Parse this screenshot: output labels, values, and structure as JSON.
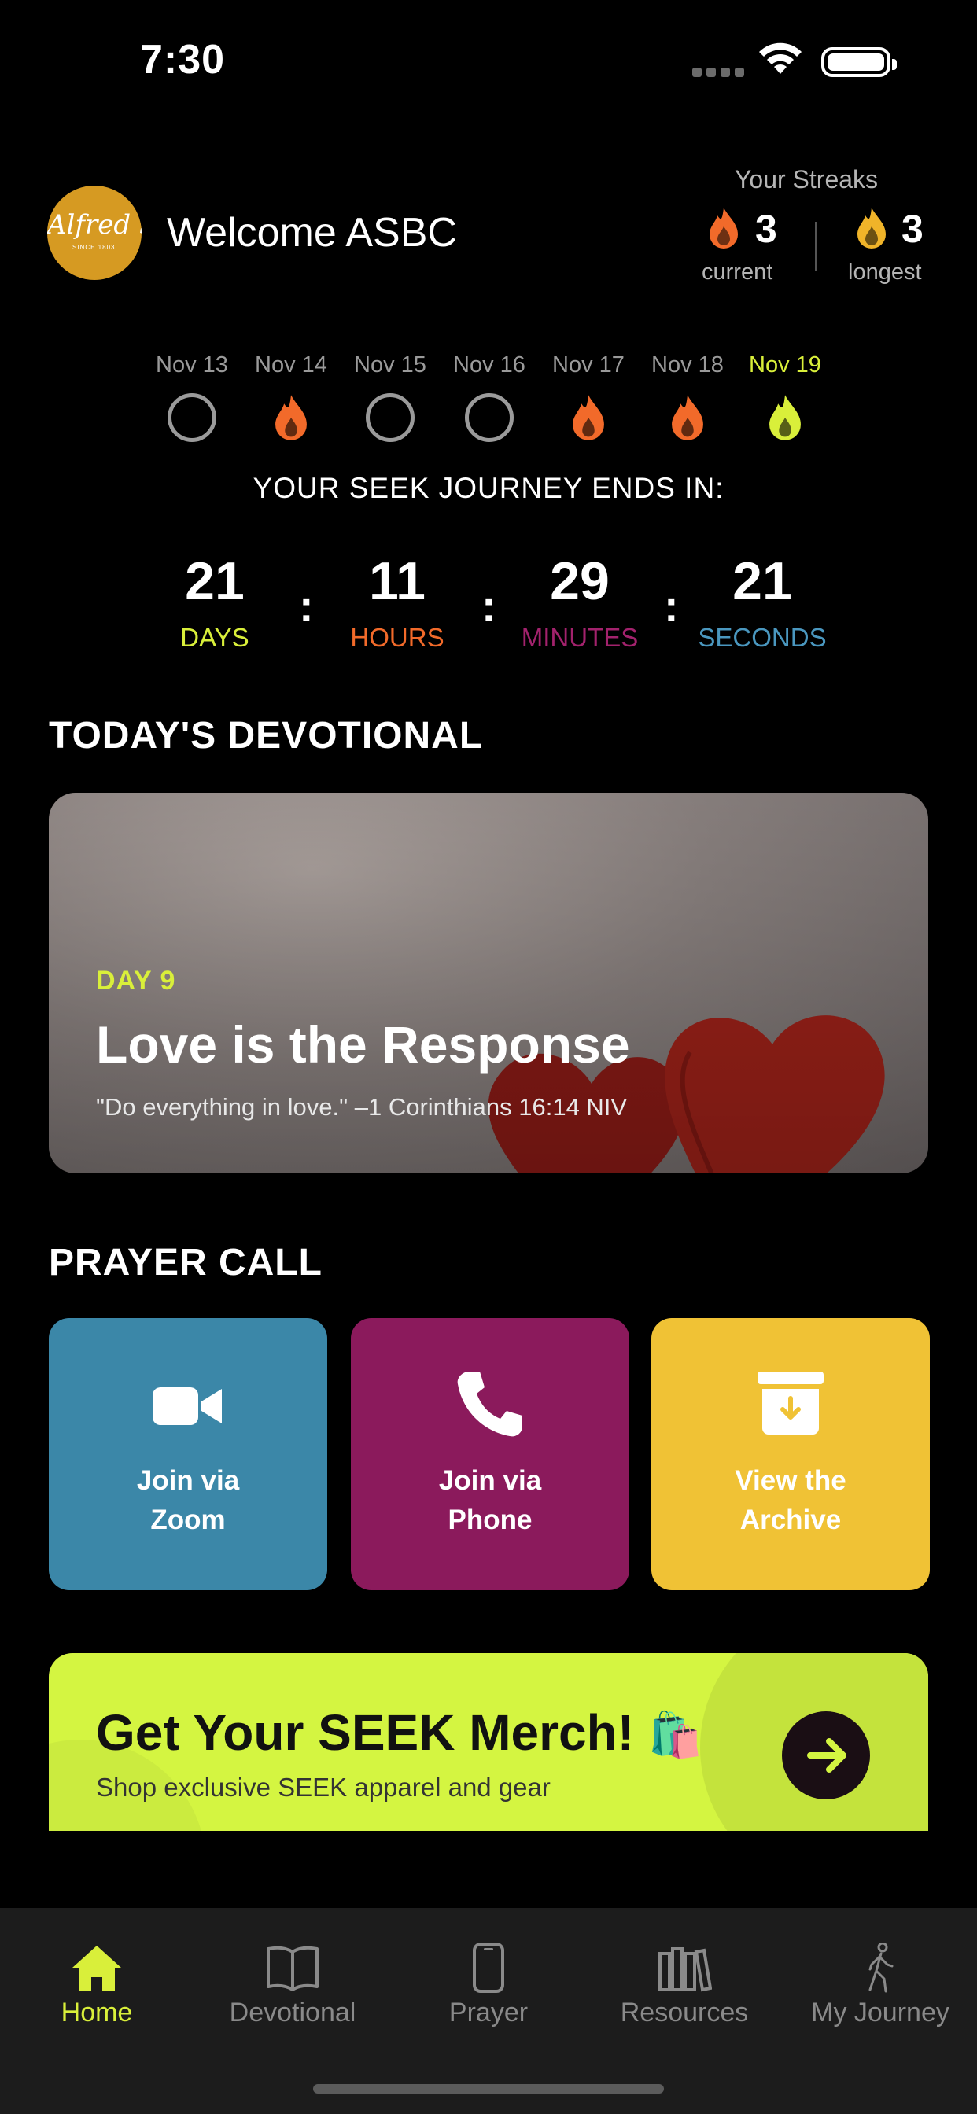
{
  "status_bar": {
    "time": "7:30"
  },
  "header": {
    "logo_text": "Alfred St",
    "logo_sub": "SINCE 1803",
    "welcome": "Welcome ASBC",
    "streaks_title": "Your Streaks",
    "current": {
      "value": "3",
      "label": "current"
    },
    "longest": {
      "value": "3",
      "label": "longest"
    }
  },
  "week": [
    {
      "label": "Nov 13",
      "status": "missed"
    },
    {
      "label": "Nov 14",
      "status": "done"
    },
    {
      "label": "Nov 15",
      "status": "missed"
    },
    {
      "label": "Nov 16",
      "status": "missed"
    },
    {
      "label": "Nov 17",
      "status": "done"
    },
    {
      "label": "Nov 18",
      "status": "done"
    },
    {
      "label": "Nov 19",
      "status": "today"
    }
  ],
  "countdown": {
    "title": "YOUR SEEK JOURNEY ENDS IN:",
    "days": {
      "value": "21",
      "label": "DAYS",
      "color": "#d9ef3a"
    },
    "hours": {
      "value": "11",
      "label": "HOURS",
      "color": "#f26a2a"
    },
    "minutes": {
      "value": "29",
      "label": "MINUTES",
      "color": "#a3226d"
    },
    "seconds": {
      "value": "21",
      "label": "SECONDS",
      "color": "#4a97bf"
    },
    "separator": ":"
  },
  "devotional": {
    "section_title": "TODAY'S DEVOTIONAL",
    "day": "DAY 9",
    "title": "Love is the Response",
    "quote": "\"Do everything in love.\" –1 Corinthians 16:14 NIV"
  },
  "prayer": {
    "section_title": "PRAYER CALL",
    "tiles": [
      {
        "line1": "Join via",
        "line2": "Zoom",
        "color": "#3b87a8",
        "icon": "video-camera-icon"
      },
      {
        "line1": "Join via",
        "line2": "Phone",
        "color": "#8b1a5c",
        "icon": "phone-icon"
      },
      {
        "line1": "View the",
        "line2": "Archive",
        "color": "#f0c235",
        "icon": "archive-box-icon"
      }
    ]
  },
  "merch": {
    "title": "Get Your SEEK Merch!",
    "emoji": "🛍️",
    "subtitle": "Shop exclusive SEEK apparel and gear"
  },
  "tabs": [
    {
      "label": "Home",
      "icon": "home-icon",
      "active": true
    },
    {
      "label": "Devotional",
      "icon": "book-icon",
      "active": false
    },
    {
      "label": "Prayer",
      "icon": "phone-device-icon",
      "active": false
    },
    {
      "label": "Resources",
      "icon": "library-icon",
      "active": false
    },
    {
      "label": "My Journey",
      "icon": "walking-person-icon",
      "active": false
    }
  ],
  "colors": {
    "accent": "#d9ef3a",
    "flame_orange": "#f26a2a",
    "flame_gold": "#f0b429"
  }
}
